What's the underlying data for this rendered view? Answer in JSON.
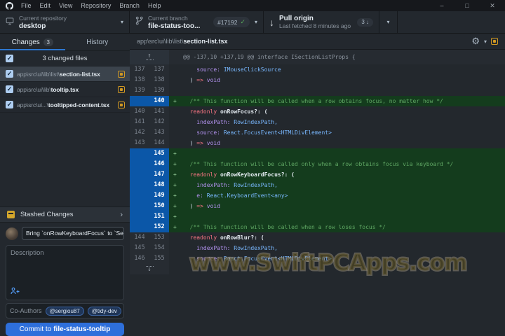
{
  "titlebar": {
    "menu": [
      "File",
      "Edit",
      "View",
      "Repository",
      "Branch",
      "Help"
    ],
    "controls": [
      {
        "name": "minimize",
        "glyph": "–"
      },
      {
        "name": "maximize",
        "glyph": "□"
      },
      {
        "name": "close",
        "glyph": "✕"
      }
    ]
  },
  "toolbar": {
    "repository": {
      "label": "Current repository",
      "value": "desktop"
    },
    "branch": {
      "label": "Current branch",
      "value": "file-status-too...",
      "pr_badge": "#17192"
    },
    "pull": {
      "title": "Pull origin",
      "subtitle": "Last fetched 8 minutes ago",
      "badge": "3"
    }
  },
  "sidebar": {
    "tabs": [
      {
        "label": "Changes",
        "badge": "3"
      },
      {
        "label": "History"
      }
    ],
    "files_header": {
      "label": "3 changed files"
    },
    "files": [
      {
        "dir": "app\\src\\ui\\lib\\list\\",
        "name": "section-list.tsx",
        "status": "modified",
        "selected": true
      },
      {
        "dir": "app\\src\\ui\\lib\\",
        "name": "tooltip.tsx",
        "status": "modified",
        "selected": false
      },
      {
        "dir": "app\\src\\ui...\\",
        "name": "tooltipped-content.tsx",
        "status": "modified",
        "selected": false
      }
    ],
    "stash": {
      "label": "Stashed Changes"
    },
    "commit": {
      "summary_value": "Bring `onRowKeyboardFocus` to `Se",
      "description_placeholder": "Description",
      "coauthors_label": "Co-Authors",
      "coauthors": [
        "@sergiou87",
        "@tidy-dev"
      ],
      "button_prefix": "Commit to ",
      "button_branch": "file-status-tooltip"
    }
  },
  "diff": {
    "file_dir": "app\\src\\ui\\lib\\list\\",
    "file_name": "section-list.tsx",
    "hunk_header": "@@ -137,10 +137,19 @@ interface ISectionListProps {",
    "lines": [
      {
        "old": "137",
        "new": "137",
        "type": "context",
        "tokens": [
          [
            "    ",
            ""
          ],
          [
            "source:",
            "pur"
          ],
          [
            " ",
            ""
          ],
          [
            "IMouseClickSource",
            "blu"
          ]
        ]
      },
      {
        "old": "138",
        "new": "138",
        "type": "context",
        "tokens": [
          [
            "  ",
            ""
          ],
          [
            ") ",
            ""
          ],
          [
            "=>",
            "red"
          ],
          [
            " ",
            ""
          ],
          [
            "void",
            "pur"
          ]
        ]
      },
      {
        "old": "139",
        "new": "139",
        "type": "context",
        "tokens": []
      },
      {
        "old": "",
        "new": "140",
        "type": "added",
        "tokens": [
          [
            "  ",
            ""
          ],
          [
            "/** This function will be called when a row obtains focus, no matter how */",
            "grn"
          ]
        ]
      },
      {
        "old": "140",
        "new": "141",
        "type": "context",
        "tokens": [
          [
            "  ",
            ""
          ],
          [
            "readonly",
            "red"
          ],
          [
            " ",
            ""
          ],
          [
            "onRowFocus?: (",
            "fn"
          ]
        ]
      },
      {
        "old": "141",
        "new": "142",
        "type": "context",
        "tokens": [
          [
            "    ",
            ""
          ],
          [
            "indexPath:",
            "pur"
          ],
          [
            " ",
            ""
          ],
          [
            "RowIndexPath,",
            "blu"
          ]
        ]
      },
      {
        "old": "142",
        "new": "143",
        "type": "context",
        "tokens": [
          [
            "    ",
            ""
          ],
          [
            "source:",
            "pur"
          ],
          [
            " ",
            ""
          ],
          [
            "React.FocusEvent<HTMLDivElement>",
            "blu"
          ]
        ]
      },
      {
        "old": "143",
        "new": "144",
        "type": "context",
        "tokens": [
          [
            "  ",
            ""
          ],
          [
            ") ",
            ""
          ],
          [
            "=>",
            "red"
          ],
          [
            " ",
            ""
          ],
          [
            "void",
            "pur"
          ]
        ]
      },
      {
        "old": "",
        "new": "145",
        "type": "added",
        "tokens": []
      },
      {
        "old": "",
        "new": "146",
        "type": "added",
        "tokens": [
          [
            "  ",
            ""
          ],
          [
            "/** This function will be called only when a row obtains focus via keyboard */",
            "grn"
          ]
        ]
      },
      {
        "old": "",
        "new": "147",
        "type": "added",
        "tokens": [
          [
            "  ",
            ""
          ],
          [
            "readonly",
            "red"
          ],
          [
            " ",
            ""
          ],
          [
            "onRowKeyboardFocus?: (",
            "fn"
          ]
        ]
      },
      {
        "old": "",
        "new": "148",
        "type": "added",
        "tokens": [
          [
            "    ",
            ""
          ],
          [
            "indexPath:",
            "pur"
          ],
          [
            " ",
            ""
          ],
          [
            "RowIndexPath,",
            "blu"
          ]
        ]
      },
      {
        "old": "",
        "new": "149",
        "type": "added",
        "tokens": [
          [
            "    ",
            ""
          ],
          [
            "e:",
            "pur"
          ],
          [
            " ",
            ""
          ],
          [
            "React.KeyboardEvent<any>",
            "blu"
          ]
        ]
      },
      {
        "old": "",
        "new": "150",
        "type": "added",
        "tokens": [
          [
            "  ",
            ""
          ],
          [
            ") ",
            ""
          ],
          [
            "=>",
            "red"
          ],
          [
            " ",
            ""
          ],
          [
            "void",
            "pur"
          ]
        ]
      },
      {
        "old": "",
        "new": "151",
        "type": "added",
        "tokens": []
      },
      {
        "old": "",
        "new": "152",
        "type": "added",
        "tokens": [
          [
            "  ",
            ""
          ],
          [
            "/** This function will be called when a row loses focus */",
            "grn"
          ]
        ]
      },
      {
        "old": "144",
        "new": "153",
        "type": "context",
        "tokens": [
          [
            "  ",
            ""
          ],
          [
            "readonly",
            "red"
          ],
          [
            " ",
            ""
          ],
          [
            "onRowBlur?: (",
            "fn"
          ]
        ]
      },
      {
        "old": "145",
        "new": "154",
        "type": "context",
        "tokens": [
          [
            "    ",
            ""
          ],
          [
            "indexPath:",
            "pur"
          ],
          [
            " ",
            ""
          ],
          [
            "RowIndexPath,",
            "blu"
          ]
        ]
      },
      {
        "old": "146",
        "new": "155",
        "type": "context",
        "tokens": [
          [
            "    ",
            ""
          ],
          [
            "source:",
            "pur"
          ],
          [
            " ",
            ""
          ],
          [
            "React.FocusEvent<HTMLDivElement>",
            "blu"
          ]
        ]
      }
    ]
  },
  "watermark": "www.SwiftPCApps.com"
}
